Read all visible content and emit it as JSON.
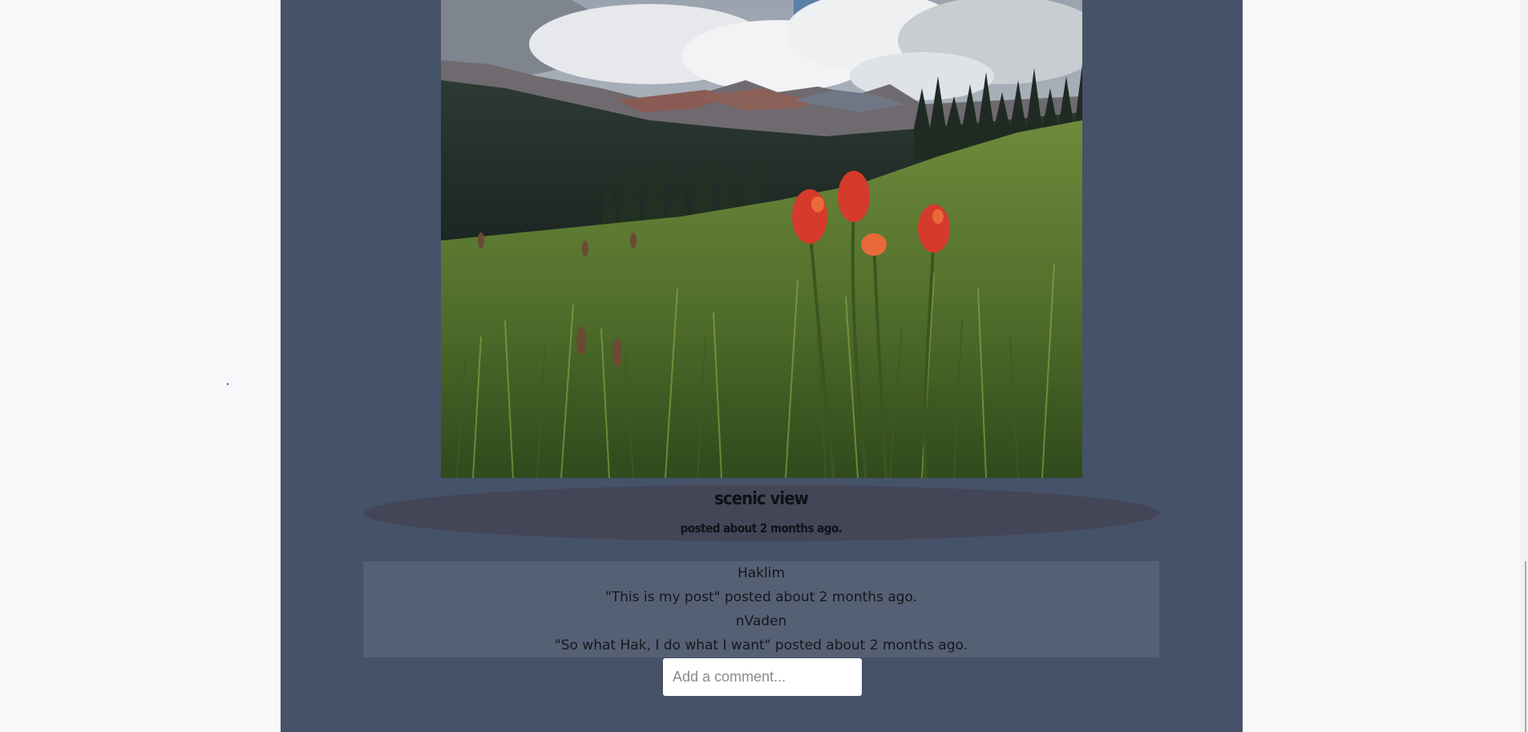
{
  "post": {
    "image_alt": "",
    "title": "scenic view",
    "posted_text": "posted about 2 months ago."
  },
  "comments": [
    {
      "author": "Haklim",
      "text": "\"This is my post\" posted about 2 months ago."
    },
    {
      "author": "nVaden",
      "text": "\"So what Hak, I do what I want\" posted about 2 months ago."
    }
  ],
  "comment_form": {
    "placeholder": "Add a comment..."
  },
  "colors": {
    "page_background": "#f7f8f9",
    "column_background": "#465268",
    "caption_background": "#434657",
    "comments_background": "#566074"
  }
}
